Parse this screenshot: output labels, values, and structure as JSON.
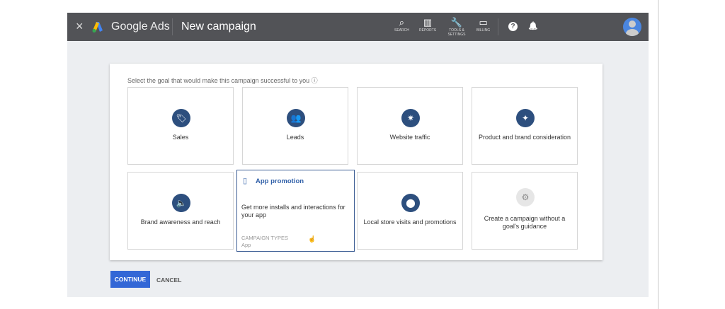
{
  "header": {
    "close": "×",
    "brand": "Google Ads",
    "title": "New campaign",
    "tools": [
      {
        "icon": "search-icon",
        "glyph": "⌕",
        "label": "SEARCH"
      },
      {
        "icon": "reports-icon",
        "glyph": "▥",
        "label": "REPORTS"
      },
      {
        "icon": "wrench-icon",
        "glyph": "🔧",
        "label": "TOOLS & SETTINGS"
      },
      {
        "icon": "billing-icon",
        "glyph": "▭",
        "label": "BILLING"
      }
    ],
    "help": "?",
    "bell": "🔔"
  },
  "main": {
    "prompt": "Select the goal that would make this campaign successful to you ⓘ",
    "goals": [
      {
        "label": "Sales",
        "glyph": "🏷"
      },
      {
        "label": "Leads",
        "glyph": "👥"
      },
      {
        "label": "Website traffic",
        "glyph": "✷"
      },
      {
        "label": "Product and brand consideration",
        "glyph": "✦"
      },
      {
        "label": "Brand awareness and reach",
        "glyph": "🔈"
      },
      {
        "label": "Local store visits and promotions",
        "glyph": "⬤"
      },
      {
        "label": "Create a campaign without a goal's guidance",
        "glyph": "⚙"
      }
    ],
    "selected": {
      "title": "App promotion",
      "glyph": "▯",
      "description": "Get more installs and interactions for your app",
      "types_label": "CAMPAIGN TYPES",
      "types_value": "App"
    }
  },
  "actions": {
    "continue": "CONTINUE",
    "cancel": "CANCEL"
  },
  "colors": {
    "header": "#525357",
    "accent": "#3367d6",
    "icon_circle": "#2d4f7e"
  }
}
